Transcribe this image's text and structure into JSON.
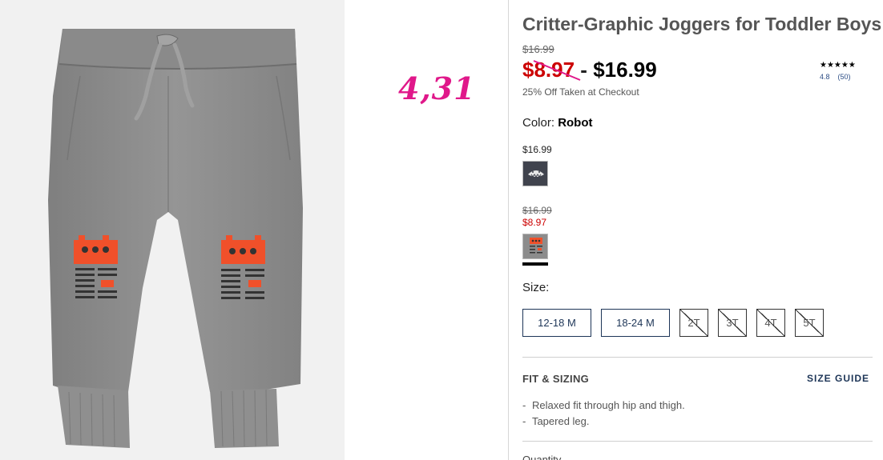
{
  "product": {
    "title": "Critter-Graphic Joggers for Toddler Boys",
    "original_price": "$16.99",
    "sale_price": "$8.97",
    "price_separator": " - ",
    "regular_price": "$16.99",
    "discount_note": "25% Off Taken at Checkout"
  },
  "rating": {
    "stars": "★★★★★",
    "score": "4.8",
    "count": "(50)",
    "value": 4.8
  },
  "annotation": {
    "handwritten_text": "4,31",
    "color": "#e0188a"
  },
  "color": {
    "label": "Color:",
    "selected": "Robot",
    "swatches": [
      {
        "name": "shark",
        "price": "$16.99"
      },
      {
        "name": "robot",
        "original_price": "$16.99",
        "sale_price": "$8.97",
        "selected": true
      }
    ]
  },
  "size": {
    "label": "Size:",
    "options": [
      {
        "label": "12-18 M",
        "available": true
      },
      {
        "label": "18-24 M",
        "available": true
      },
      {
        "label": "2T",
        "available": false
      },
      {
        "label": "3T",
        "available": false
      },
      {
        "label": "4T",
        "available": false
      },
      {
        "label": "5T",
        "available": false
      }
    ]
  },
  "fit": {
    "heading": "FIT & SIZING",
    "size_guide": "SIZE GUIDE",
    "items": [
      "Relaxed fit through hip and thigh.",
      "Tapered leg."
    ]
  },
  "quantity_label": "Quantity",
  "colors": {
    "sale_red": "#cc0000",
    "navy": "#1d3557",
    "pink": "#e0188a",
    "pants_gray": "#8c8c8c",
    "robot_orange": "#f0502a"
  }
}
